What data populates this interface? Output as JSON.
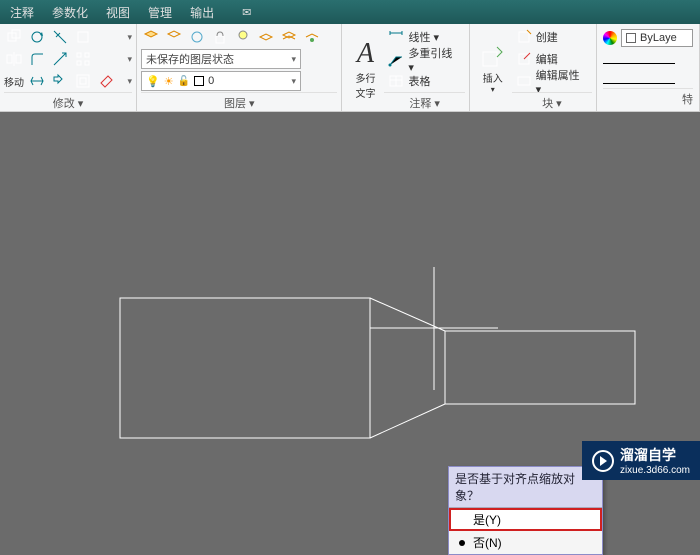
{
  "menu": {
    "items": [
      "注释",
      "参数化",
      "视图",
      "管理",
      "输出"
    ]
  },
  "panels": {
    "modify_label": "修改 ▾",
    "move_label": "移动",
    "layer_label": "图层 ▾",
    "layer_state": "未保存的图层状态",
    "layer_current": "0",
    "annot_label": "注释 ▾",
    "mtext_top": "多行",
    "mtext_bot": "文字",
    "linear": "线性 ▾",
    "mleader": "多重引线 ▾",
    "table": "表格",
    "block_label": "块 ▾",
    "insert": "插入",
    "create": "创建",
    "edit": "编辑",
    "editattr": "编辑属性 ▾",
    "bylayer": "ByLaye"
  },
  "popup": {
    "title": "是否基于对齐点缩放对象？",
    "yes": "是(Y)",
    "no": "否(N)"
  },
  "watermark": {
    "brand": "溜溜自学",
    "url": "zixue.3d66.com"
  }
}
